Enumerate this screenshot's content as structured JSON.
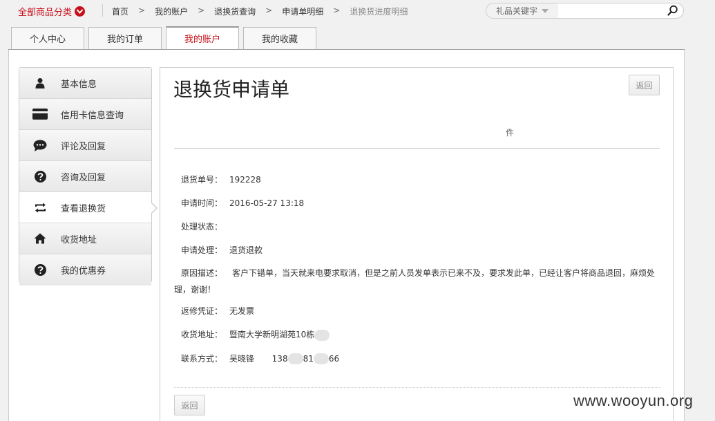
{
  "topbar": {
    "category_label": "全部商品分类",
    "breadcrumbs": [
      "首页",
      "我的账户",
      "退换货查询",
      "申请单明细",
      "退换货进度明细"
    ],
    "breadcrumb_sep": ">",
    "search": {
      "category": "礼品关键字",
      "value": "",
      "placeholder": ""
    }
  },
  "tabs": [
    {
      "label": "个人中心",
      "active": false
    },
    {
      "label": "我的订单",
      "active": false
    },
    {
      "label": "我的账户",
      "active": true
    },
    {
      "label": "我的收藏",
      "active": false
    }
  ],
  "sidebar": {
    "items": [
      {
        "label": "基本信息",
        "icon": "user-icon"
      },
      {
        "label": "信用卡信息查询",
        "icon": "credit-card-icon"
      },
      {
        "label": "评论及回复",
        "icon": "comment-icon"
      },
      {
        "label": "咨询及回复",
        "icon": "question-icon"
      },
      {
        "label": "查看退换货",
        "icon": "exchange-icon",
        "active": true
      },
      {
        "label": "收货地址",
        "icon": "home-icon"
      },
      {
        "label": "我的优惠券",
        "icon": "question-icon"
      }
    ]
  },
  "main": {
    "title": "退换货申请单",
    "back_top": "返回",
    "back_bottom": "返回",
    "steps_label": "件",
    "fields": {
      "return_no": {
        "label": "退货单号：",
        "value": "192228"
      },
      "apply_time": {
        "label": "申请时间：",
        "value": "2016-05-27 13:18"
      },
      "status": {
        "label": "处理状态：",
        "value": ""
      },
      "apply_process": {
        "label": "申请处理：",
        "value": "退货退款"
      },
      "reason": {
        "label": "原因描述：",
        "value": "客户下错单，当天就来电要求取消，但是之前人员发单表示已来不及，要求发此单，已经让客户将商品退回，麻烦处理，谢谢！"
      },
      "voucher": {
        "label": "返修凭证：",
        "value": "无发票"
      },
      "address": {
        "label": "收货地址：",
        "value": "暨南大学新明湖苑10栋"
      },
      "contact": {
        "label": "联系方式：",
        "name": "吴晓锋",
        "phone_a": "138",
        "phone_b": "81",
        "phone_c": "66"
      }
    }
  },
  "watermark": "www.wooyun.org",
  "colors": {
    "accent": "#c8101a"
  }
}
